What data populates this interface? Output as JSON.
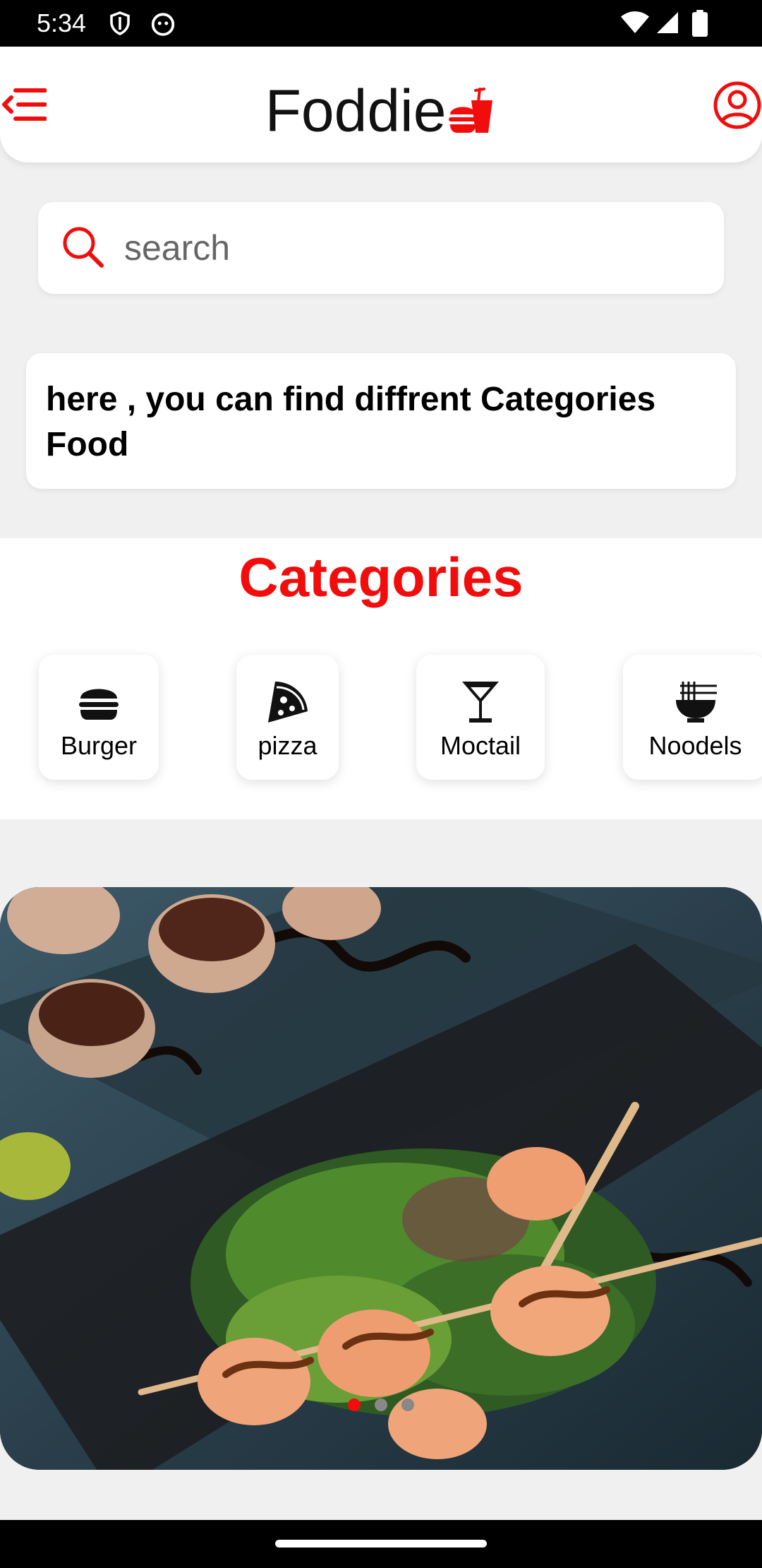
{
  "status_bar": {
    "time": "5:34"
  },
  "app_bar": {
    "title": "Foddie"
  },
  "search": {
    "placeholder": "search",
    "value": ""
  },
  "intro": {
    "text": "here , you can find diffrent Categories Food"
  },
  "categories": {
    "title": "Categories",
    "items": [
      {
        "label": "Burger",
        "icon": "burger-icon"
      },
      {
        "label": "pizza",
        "icon": "pizza-icon"
      },
      {
        "label": "Moctail",
        "icon": "cocktail-icon"
      },
      {
        "label": "Noodels",
        "icon": "noodles-icon"
      }
    ]
  },
  "banner": {
    "slide_count": 3,
    "active_slide": 1
  },
  "colors": {
    "accent": "#f20d0d",
    "background": "#f0f0f0"
  }
}
